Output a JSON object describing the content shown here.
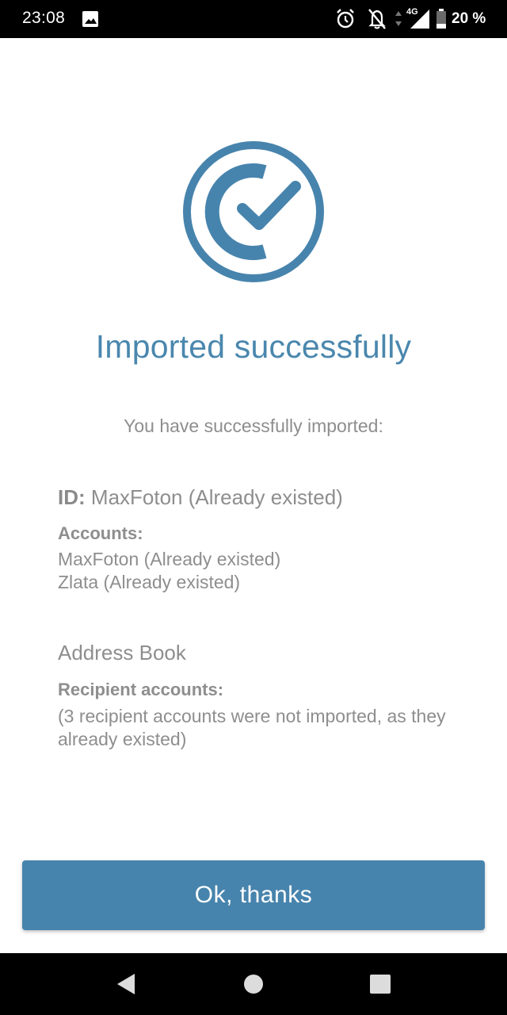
{
  "status_bar": {
    "time": "23:08",
    "network": "4G",
    "battery": "20 %",
    "icons": [
      "image-icon",
      "alarm-icon",
      "notifications-off-icon",
      "data-arrows-icon",
      "signal-icon",
      "battery-icon"
    ]
  },
  "result": {
    "icon": "check-circle-logo-icon",
    "title": "Imported successfully",
    "subtitle": "You have successfully imported:"
  },
  "identity": {
    "id_label": "ID:",
    "id_value": "MaxFoton (Already existed)",
    "accounts_label": "Accounts:",
    "accounts": [
      "MaxFoton (Already existed)",
      "Zlata (Already existed)"
    ]
  },
  "address_book": {
    "heading": "Address Book",
    "recipients_label": "Recipient accounts:",
    "recipients_note": "(3 recipient accounts were not imported, as they already existed)"
  },
  "actions": {
    "ok_label": "Ok, thanks"
  },
  "nav_bar": {
    "buttons": [
      "back-icon",
      "home-icon",
      "recents-icon"
    ]
  },
  "colors": {
    "accent": "#4784ad",
    "title": "#4a87ae",
    "text_muted": "#8e8e8e",
    "system_bars": "#000000"
  }
}
